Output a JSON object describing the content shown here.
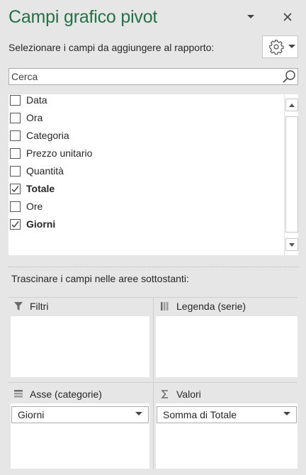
{
  "header": {
    "title": "Campi grafico pivot",
    "instruction": "Selezionare i campi da aggiungere al rapporto:",
    "dropdown_icon": "chevron-down-icon",
    "close_icon": "close-icon",
    "settings_icon": "gear-icon"
  },
  "search": {
    "placeholder": "Cerca",
    "value": ""
  },
  "fields": [
    {
      "label": "Data",
      "checked": false
    },
    {
      "label": "Ora",
      "checked": false
    },
    {
      "label": "Categoria",
      "checked": false
    },
    {
      "label": "Prezzo unitario",
      "checked": false
    },
    {
      "label": "Quantità",
      "checked": false
    },
    {
      "label": "Totale",
      "checked": true
    },
    {
      "label": "Ore",
      "checked": false
    },
    {
      "label": "Giorni",
      "checked": true
    }
  ],
  "areas": {
    "hint": "Trascinare i campi nelle aree sottostanti:",
    "filters": {
      "label": "Filtri",
      "icon": "filter-icon"
    },
    "legend": {
      "label": "Legenda (serie)",
      "icon": "columns-icon"
    },
    "axis": {
      "label": "Asse (categorie)",
      "icon": "rows-icon",
      "value": "Giorni"
    },
    "values": {
      "label": "Valori",
      "icon": "sigma-icon",
      "value": "Somma di Totale"
    }
  },
  "colors": {
    "title": "#217346",
    "panel": "#e6e6e6"
  }
}
